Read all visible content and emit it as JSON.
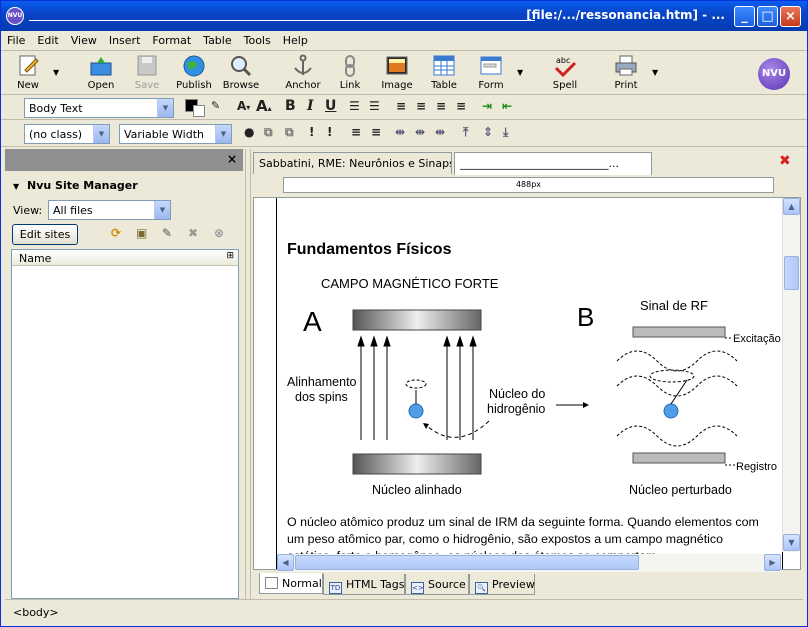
{
  "window": {
    "title": "[file:/.../ressonancia.htm] - ...",
    "app_icon_text": "NVU",
    "minimize": "_",
    "maximize": "□",
    "close": "×"
  },
  "menu": [
    "File",
    "Edit",
    "View",
    "Insert",
    "Format",
    "Table",
    "Tools",
    "Help"
  ],
  "toolbar": {
    "new": "New",
    "open": "Open",
    "save": "Save",
    "publish": "Publish",
    "browse": "Browse",
    "anchor": "Anchor",
    "link": "Link",
    "image": "Image",
    "table": "Table",
    "form": "Form",
    "spell": "Spell",
    "print": "Print",
    "logo": "NVU"
  },
  "format1": {
    "paragraph_style": "Body Text",
    "bold": "B",
    "italic": "I",
    "underline": "U"
  },
  "format2": {
    "class": "(no class)",
    "font": "Variable Width"
  },
  "sidebar": {
    "close": "×",
    "title": "Nvu Site Manager",
    "view_label": "View:",
    "view_value": "All files",
    "edit_sites": "Edit sites",
    "column_name": "Name"
  },
  "editor": {
    "tabs": [
      {
        "label": "Sabbatini, RME: Neurônios e Sinapse..."
      },
      {
        "label": "___________________________..."
      }
    ],
    "ruler": "488px",
    "heading": "Fundamentos Físicos",
    "paragraph": "O núcleo atômico produz um sinal de IRM da seguinte forma. Quando elementos com um peso atômico par, como o hidrogênio, são expostos a um campo magnético estático, forte e homogêneo, os núcleos dos átomos se comportam",
    "figure": {
      "title": "CAMPO MAGNÉTICO FORTE",
      "label_a": "A",
      "label_b": "B",
      "rf_signal": "Sinal de RF",
      "excitation": "Excitação",
      "register": "Registro",
      "spin_alignment_1": "Alinhamento",
      "spin_alignment_2": "dos spins",
      "nucleus_1": "Núcleo do",
      "nucleus_2": "hidrogênio",
      "aligned": "Núcleo alinhado",
      "disturbed": "Núcleo perturbado"
    }
  },
  "modes": [
    "Normal",
    "HTML Tags",
    "Source",
    "Preview"
  ],
  "status": "<body>"
}
